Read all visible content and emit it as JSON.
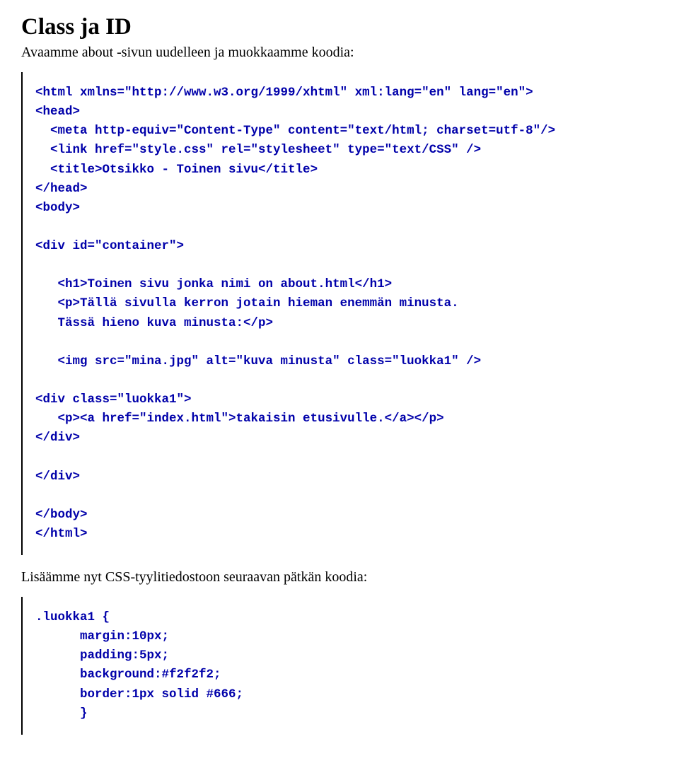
{
  "heading": "Class ja ID",
  "intro": "Avaamme about -sivun uudelleen ja muokkaamme koodia:",
  "code1": "<html xmlns=\"http://www.w3.org/1999/xhtml\" xml:lang=\"en\" lang=\"en\">\n<head>\n  <meta http-equiv=\"Content-Type\" content=\"text/html; charset=utf-8\"/>\n  <link href=\"style.css\" rel=\"stylesheet\" type=\"text/CSS\" />\n  <title>Otsikko - Toinen sivu</title>\n</head>\n<body>\n\n<div id=\"container\">\n\n   <h1>Toinen sivu jonka nimi on about.html</h1>\n   <p>Tällä sivulla kerron jotain hieman enemmän minusta.\n   Tässä hieno kuva minusta:</p>\n\n   <img src=\"mina.jpg\" alt=\"kuva minusta\" class=\"luokka1\" />\n\n<div class=\"luokka1\">\n   <p><a href=\"index.html\">takaisin etusivulle.</a></p>\n</div>\n\n</div>\n\n</body>\n</html>",
  "mid": "Lisäämme nyt CSS-tyylitiedostoon seuraavan pätkän koodia:",
  "code2": ".luokka1 {\n      margin:10px;\n      padding:5px;\n      background:#f2f2f2;\n      border:1px solid #666;\n      }"
}
